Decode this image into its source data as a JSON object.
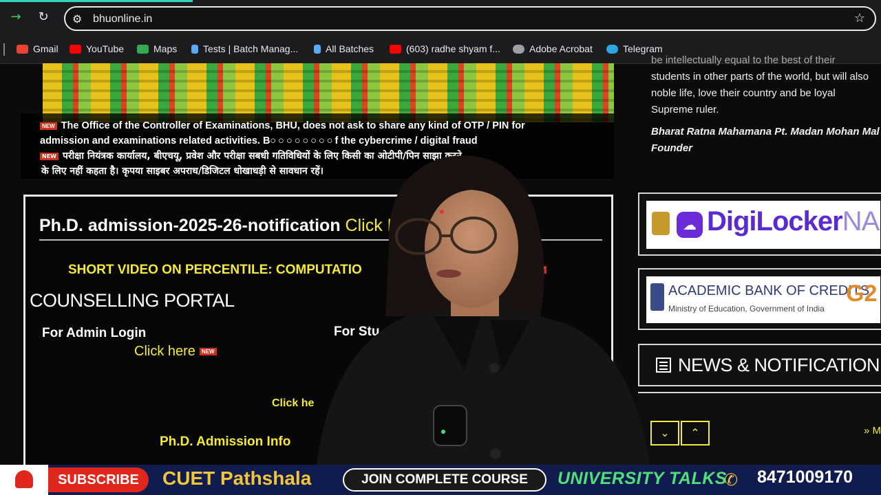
{
  "browser": {
    "url": "bhuonline.in",
    "bookmarks": [
      {
        "label": "Gmail",
        "color": "#ea4335"
      },
      {
        "label": "YouTube",
        "color": "#ff0000"
      },
      {
        "label": "Maps",
        "color": "#34a853"
      },
      {
        "label": "Tests | Batch Manag...",
        "color": "#5aa9f5"
      },
      {
        "label": "All Batches",
        "color": "#5aa9f5"
      },
      {
        "label": "(603) radhe shyam f...",
        "color": "#ff0000"
      },
      {
        "label": "Adobe Acrobat",
        "color": "#9aa0a6"
      },
      {
        "label": "Telegram",
        "color": "#2aa6e0"
      }
    ]
  },
  "notice": {
    "new_label": "NEW",
    "en_line1": "The Office of the Controller of Examinations, BHU, does not ask to share any kind of OTP / PIN for",
    "en_line2_a": "admission and examinations related activities. B",
    "en_line2_b": "f the cybercrime / digital fraud",
    "hi_line1": "परीक्षा नियंत्रक कार्यालय, बीएचयू, प्रवेश और परीक्षा सबधी गतिविधियों के लिए किसी",
    "hi_line1_b": "का ओटीपी/पिन साझा करने",
    "hi_line2": "के लिए नहीं कहता है। कृपया साइबर अपराध/डिजिटल धोखाधड़ी से सावधान रहें।"
  },
  "phd": {
    "title": "Ph.D. admission-2025-26-notification",
    "title_click": "Click H",
    "video_line": "SHORT VIDEO ON PERCENTILE: COMPUTATIO",
    "video_line_end": "N",
    "counselling": "COUNSELLING PORTAL",
    "admin_login": "For Admin Login",
    "student_login": "For Stu",
    "click_here": "Click here",
    "click_here2": "Click he",
    "phd_info": "Ph.D. Admission Info"
  },
  "sidebar": {
    "quote_lines": [
      "be intellectually equal to the best of their",
      "students in other parts of the world, but will also",
      "noble life, love their country and be loyal",
      "Supreme ruler."
    ],
    "author": "Bharat Ratna Mahamana Pt. Madan Mohan Mal",
    "author_role": "Founder",
    "digilocker": "DigiLocker",
    "digilocker_suffix": "NA",
    "abc_title": "ACADEMIC BANK OF CREDITS",
    "abc_sub": "Ministry of Education, Government of India",
    "g20": "G2",
    "news_title": "NEWS & NOTIFICATION",
    "down_icon": "chevron-down-icon",
    "up_icon": "chevron-up-icon",
    "more": "» M"
  },
  "ticker": {
    "subscribe": "SUBSCRIBE",
    "brand": "CUET Pathshala",
    "join": "JOIN COMPLETE COURSE",
    "university": "UNIVERSITY TALKS",
    "phone": "8471009170"
  }
}
